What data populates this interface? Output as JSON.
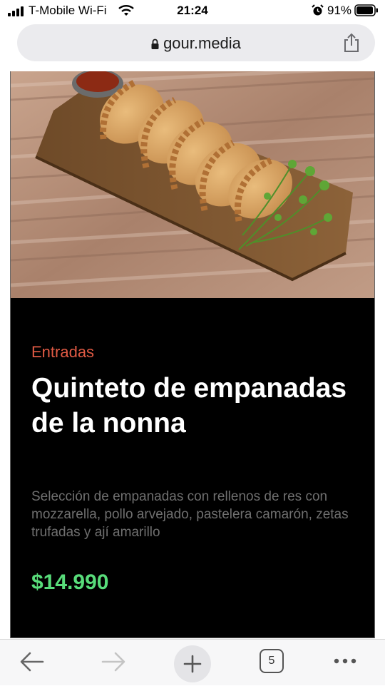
{
  "status_bar": {
    "carrier": "T-Mobile Wi-Fi",
    "time": "21:24",
    "battery_percent": "91%",
    "icons": [
      "signal-icon",
      "wifi-icon",
      "alarm-icon",
      "battery-icon"
    ]
  },
  "url_bar": {
    "url": "gour.media",
    "icons": [
      "lock-icon",
      "share-icon"
    ]
  },
  "menu_item": {
    "category": "Entradas",
    "title": "Quinteto de empanadas de la nonna",
    "description": "Selección de empanadas con rellenos de res con mozzarella, pollo arvejado, pastelera camarón, zetas trufadas y ají amarillo",
    "price": "$14.990"
  },
  "toolbar": {
    "tab_count": "5",
    "icons": [
      "back-arrow-icon",
      "forward-arrow-icon",
      "plus-icon",
      "tabs-icon",
      "more-icon"
    ]
  },
  "colors": {
    "category": "#e05a44",
    "price": "#58dc7a",
    "card_background": "#000000",
    "description": "#6f6f6f"
  }
}
